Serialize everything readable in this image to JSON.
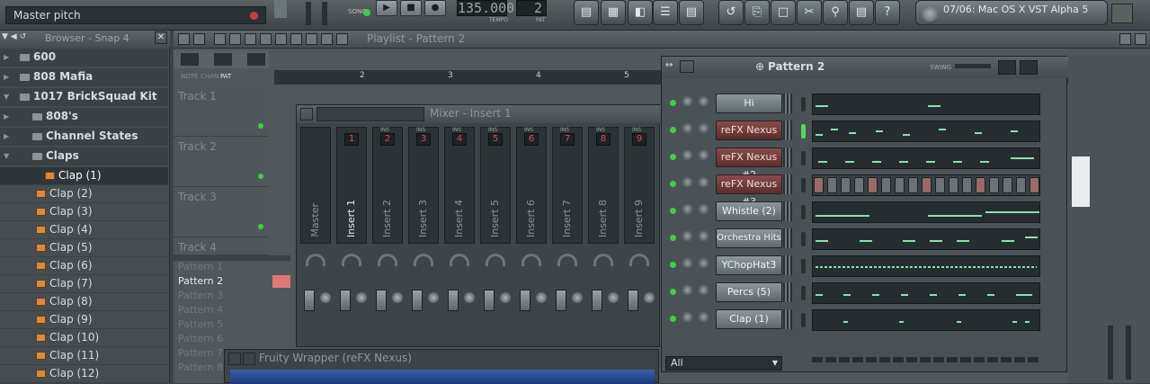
{
  "hint_bar": {
    "text": "Master pitch"
  },
  "transport": {
    "song_label": "SONG",
    "tempo_value": "135.000",
    "tempo_label": "TEMPO",
    "pattern_value": "2",
    "pattern_label": "PAT"
  },
  "plugin_selector": {
    "text": "07/06: Mac OS X VST Alpha 5"
  },
  "browser": {
    "title": "Browser - Snap 4",
    "items": [
      {
        "label": "600",
        "type": "folder"
      },
      {
        "label": "808 Mafia",
        "type": "folder"
      },
      {
        "label": "1017 BrickSquad Kit",
        "type": "folder"
      },
      {
        "label": "808's",
        "type": "folder"
      },
      {
        "label": "Channel States",
        "type": "folder"
      },
      {
        "label": "Claps",
        "type": "folder"
      },
      {
        "label": "Clap (1)",
        "type": "file",
        "selected": true
      },
      {
        "label": "Clap (2)",
        "type": "file"
      },
      {
        "label": "Clap (3)",
        "type": "file"
      },
      {
        "label": "Clap (4)",
        "type": "file"
      },
      {
        "label": "Clap (5)",
        "type": "file"
      },
      {
        "label": "Clap (6)",
        "type": "file"
      },
      {
        "label": "Clap (7)",
        "type": "file"
      },
      {
        "label": "Clap (8)",
        "type": "file"
      },
      {
        "label": "Clap (9)",
        "type": "file"
      },
      {
        "label": "Clap (10)",
        "type": "file"
      },
      {
        "label": "Clap (11)",
        "type": "file"
      },
      {
        "label": "Clap (12)",
        "type": "file"
      }
    ]
  },
  "playlist": {
    "title": "Playlist - Pattern 2",
    "tabs": [
      "NOTE",
      "CHAN",
      "PAT"
    ],
    "tracks": [
      "Track 1",
      "Track 2",
      "Track 3",
      "Track 4"
    ],
    "patterns": [
      "Pattern 1",
      "Pattern 2",
      "Pattern 3",
      "Pattern 4",
      "Pattern 5",
      "Pattern 6",
      "Pattern 7",
      "Pattern 8"
    ],
    "selected_pattern": "Pattern 2",
    "ruler": [
      "2",
      "3",
      "4",
      "5"
    ]
  },
  "mixer": {
    "title": "Mixer - Insert 1",
    "ins_label": "INS",
    "strips": [
      "Master",
      "Insert 1",
      "Insert 2",
      "Insert 3",
      "Insert 4",
      "Insert 5",
      "Insert 6",
      "Insert 7",
      "Insert 8",
      "Insert 9"
    ],
    "numbers": [
      "1",
      "2",
      "3",
      "4",
      "5",
      "6",
      "7",
      "8",
      "9"
    ],
    "selected": "Insert 1"
  },
  "step_sequencer": {
    "title": "Pattern 2",
    "swing_label": "SWING",
    "filter": "All",
    "channels": [
      {
        "name": "Hi",
        "style": "grey"
      },
      {
        "name": "reFX Nexus",
        "style": "red",
        "selected": true
      },
      {
        "name": "reFX Nexus #2",
        "style": "red"
      },
      {
        "name": "reFX Nexus #3",
        "style": "red"
      },
      {
        "name": "Whistle (2)",
        "style": "grey"
      },
      {
        "name": "Orchestra Hits",
        "style": "grey"
      },
      {
        "name": "YChopHat3",
        "style": "grey"
      },
      {
        "name": "Percs (5)",
        "style": "grey"
      },
      {
        "name": "Clap (1)",
        "style": "grey"
      }
    ]
  },
  "wrapper": {
    "title": "Fruity Wrapper (reFX Nexus)"
  },
  "colors": {
    "accent_green": "#3ecf4a",
    "record_red": "#c04040",
    "note_green": "#8fe0a8"
  }
}
